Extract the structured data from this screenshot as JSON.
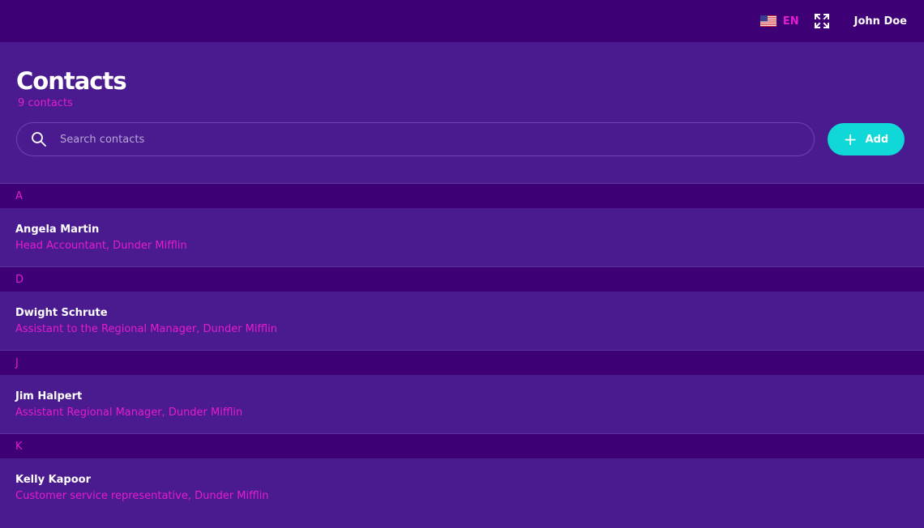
{
  "topbar": {
    "language_code": "EN",
    "user_name": "John Doe"
  },
  "header": {
    "title": "Contacts",
    "count_label": "9 contacts"
  },
  "search": {
    "placeholder": "Search contacts"
  },
  "actions": {
    "add_label": "Add"
  },
  "groups": [
    {
      "letter": "A",
      "contacts": [
        {
          "name": "Angela Martin",
          "role": "Head Accountant, Dunder Mifflin"
        }
      ]
    },
    {
      "letter": "D",
      "contacts": [
        {
          "name": "Dwight Schrute",
          "role": "Assistant to the Regional Manager, Dunder Mifflin"
        }
      ]
    },
    {
      "letter": "J",
      "contacts": [
        {
          "name": "Jim Halpert",
          "role": "Assistant Regional Manager, Dunder Mifflin"
        }
      ]
    },
    {
      "letter": "K",
      "contacts": [
        {
          "name": "Kelly Kapoor",
          "role": "Customer service representative, Dunder Mifflin"
        }
      ]
    }
  ],
  "icons": {
    "language": "us-flag-icon",
    "fullscreen": "fullscreen-icon",
    "search": "search-icon",
    "add": "plus-icon"
  },
  "colors": {
    "topbar_bg": "#3d0075",
    "page_bg": "#4a1b8f",
    "accent_pink": "#e41ccf",
    "button_cyan": "#10d8d8"
  }
}
